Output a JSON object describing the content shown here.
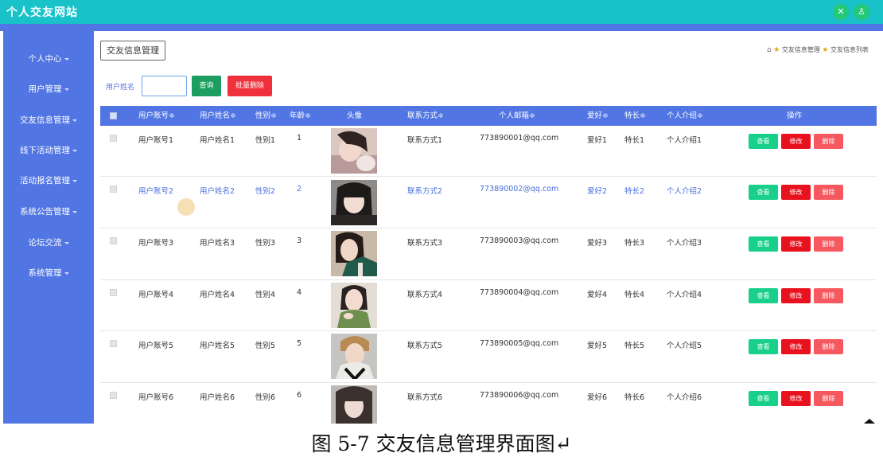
{
  "app": {
    "title": "个人交友网站"
  },
  "header_icons": [
    {
      "name": "fullscreen-icon",
      "glyph": "✕",
      "color": "#24c978"
    },
    {
      "name": "user-icon",
      "glyph": "♙",
      "color": "#24c978"
    }
  ],
  "sidebar": {
    "items": [
      {
        "label": "个人中心"
      },
      {
        "label": "用户管理"
      },
      {
        "label": "交友信息管理"
      },
      {
        "label": "线下活动管理"
      },
      {
        "label": "活动报名管理"
      },
      {
        "label": "系统公告管理"
      },
      {
        "label": "论坛交流"
      },
      {
        "label": "系统管理"
      }
    ]
  },
  "page": {
    "title_button": "交友信息管理",
    "breadcrumb": {
      "first": "交友信息管理",
      "second": "交友信息列表"
    }
  },
  "search": {
    "label": "用户姓名",
    "value": "",
    "query_button": "查询",
    "batch_delete_button": "批量删除"
  },
  "table": {
    "headers": [
      "用户账号≑",
      "用户姓名≑",
      "性别≑",
      "年龄≑",
      "头像",
      "联系方式≑",
      "个人邮箱≑",
      "爱好≑",
      "特长≑",
      "个人介绍≑",
      "操作"
    ],
    "rows": [
      {
        "account": "用户账号1",
        "name": "用户姓名1",
        "gender": "性别1",
        "age": "1",
        "contact": "联系方式1",
        "email": "773890001@qq.com",
        "hobby": "爱好1",
        "skill": "特长1",
        "intro": "个人介绍1"
      },
      {
        "account": "用户账号2",
        "name": "用户姓名2",
        "gender": "性别2",
        "age": "2",
        "contact": "联系方式2",
        "email": "773890002@qq.com",
        "hobby": "爱好2",
        "skill": "特长2",
        "intro": "个人介绍2"
      },
      {
        "account": "用户账号3",
        "name": "用户姓名3",
        "gender": "性别3",
        "age": "3",
        "contact": "联系方式3",
        "email": "773890003@qq.com",
        "hobby": "爱好3",
        "skill": "特长3",
        "intro": "个人介绍3"
      },
      {
        "account": "用户账号4",
        "name": "用户姓名4",
        "gender": "性别4",
        "age": "4",
        "contact": "联系方式4",
        "email": "773890004@qq.com",
        "hobby": "爱好4",
        "skill": "特长4",
        "intro": "个人介绍4"
      },
      {
        "account": "用户账号5",
        "name": "用户姓名5",
        "gender": "性别5",
        "age": "5",
        "contact": "联系方式5",
        "email": "773890005@qq.com",
        "hobby": "爱好5",
        "skill": "特长5",
        "intro": "个人介绍5"
      },
      {
        "account": "用户账号6",
        "name": "用户姓名6",
        "gender": "性别6",
        "age": "6",
        "contact": "联系方式6",
        "email": "773890006@qq.com",
        "hobby": "爱好6",
        "skill": "特长6",
        "intro": "个人介绍6"
      }
    ],
    "actions": {
      "view": "查看",
      "edit": "修改",
      "delete": "删除"
    }
  },
  "caption": "图 5-7 交友信息管理界面图↵",
  "colors": {
    "topbar": "#19c1c9",
    "sidebar": "#5175e3",
    "query": "#1b9e5f",
    "danger": "#f0303a",
    "view": "#19d08a",
    "edit": "#e8121e",
    "delete": "#f5595f"
  }
}
